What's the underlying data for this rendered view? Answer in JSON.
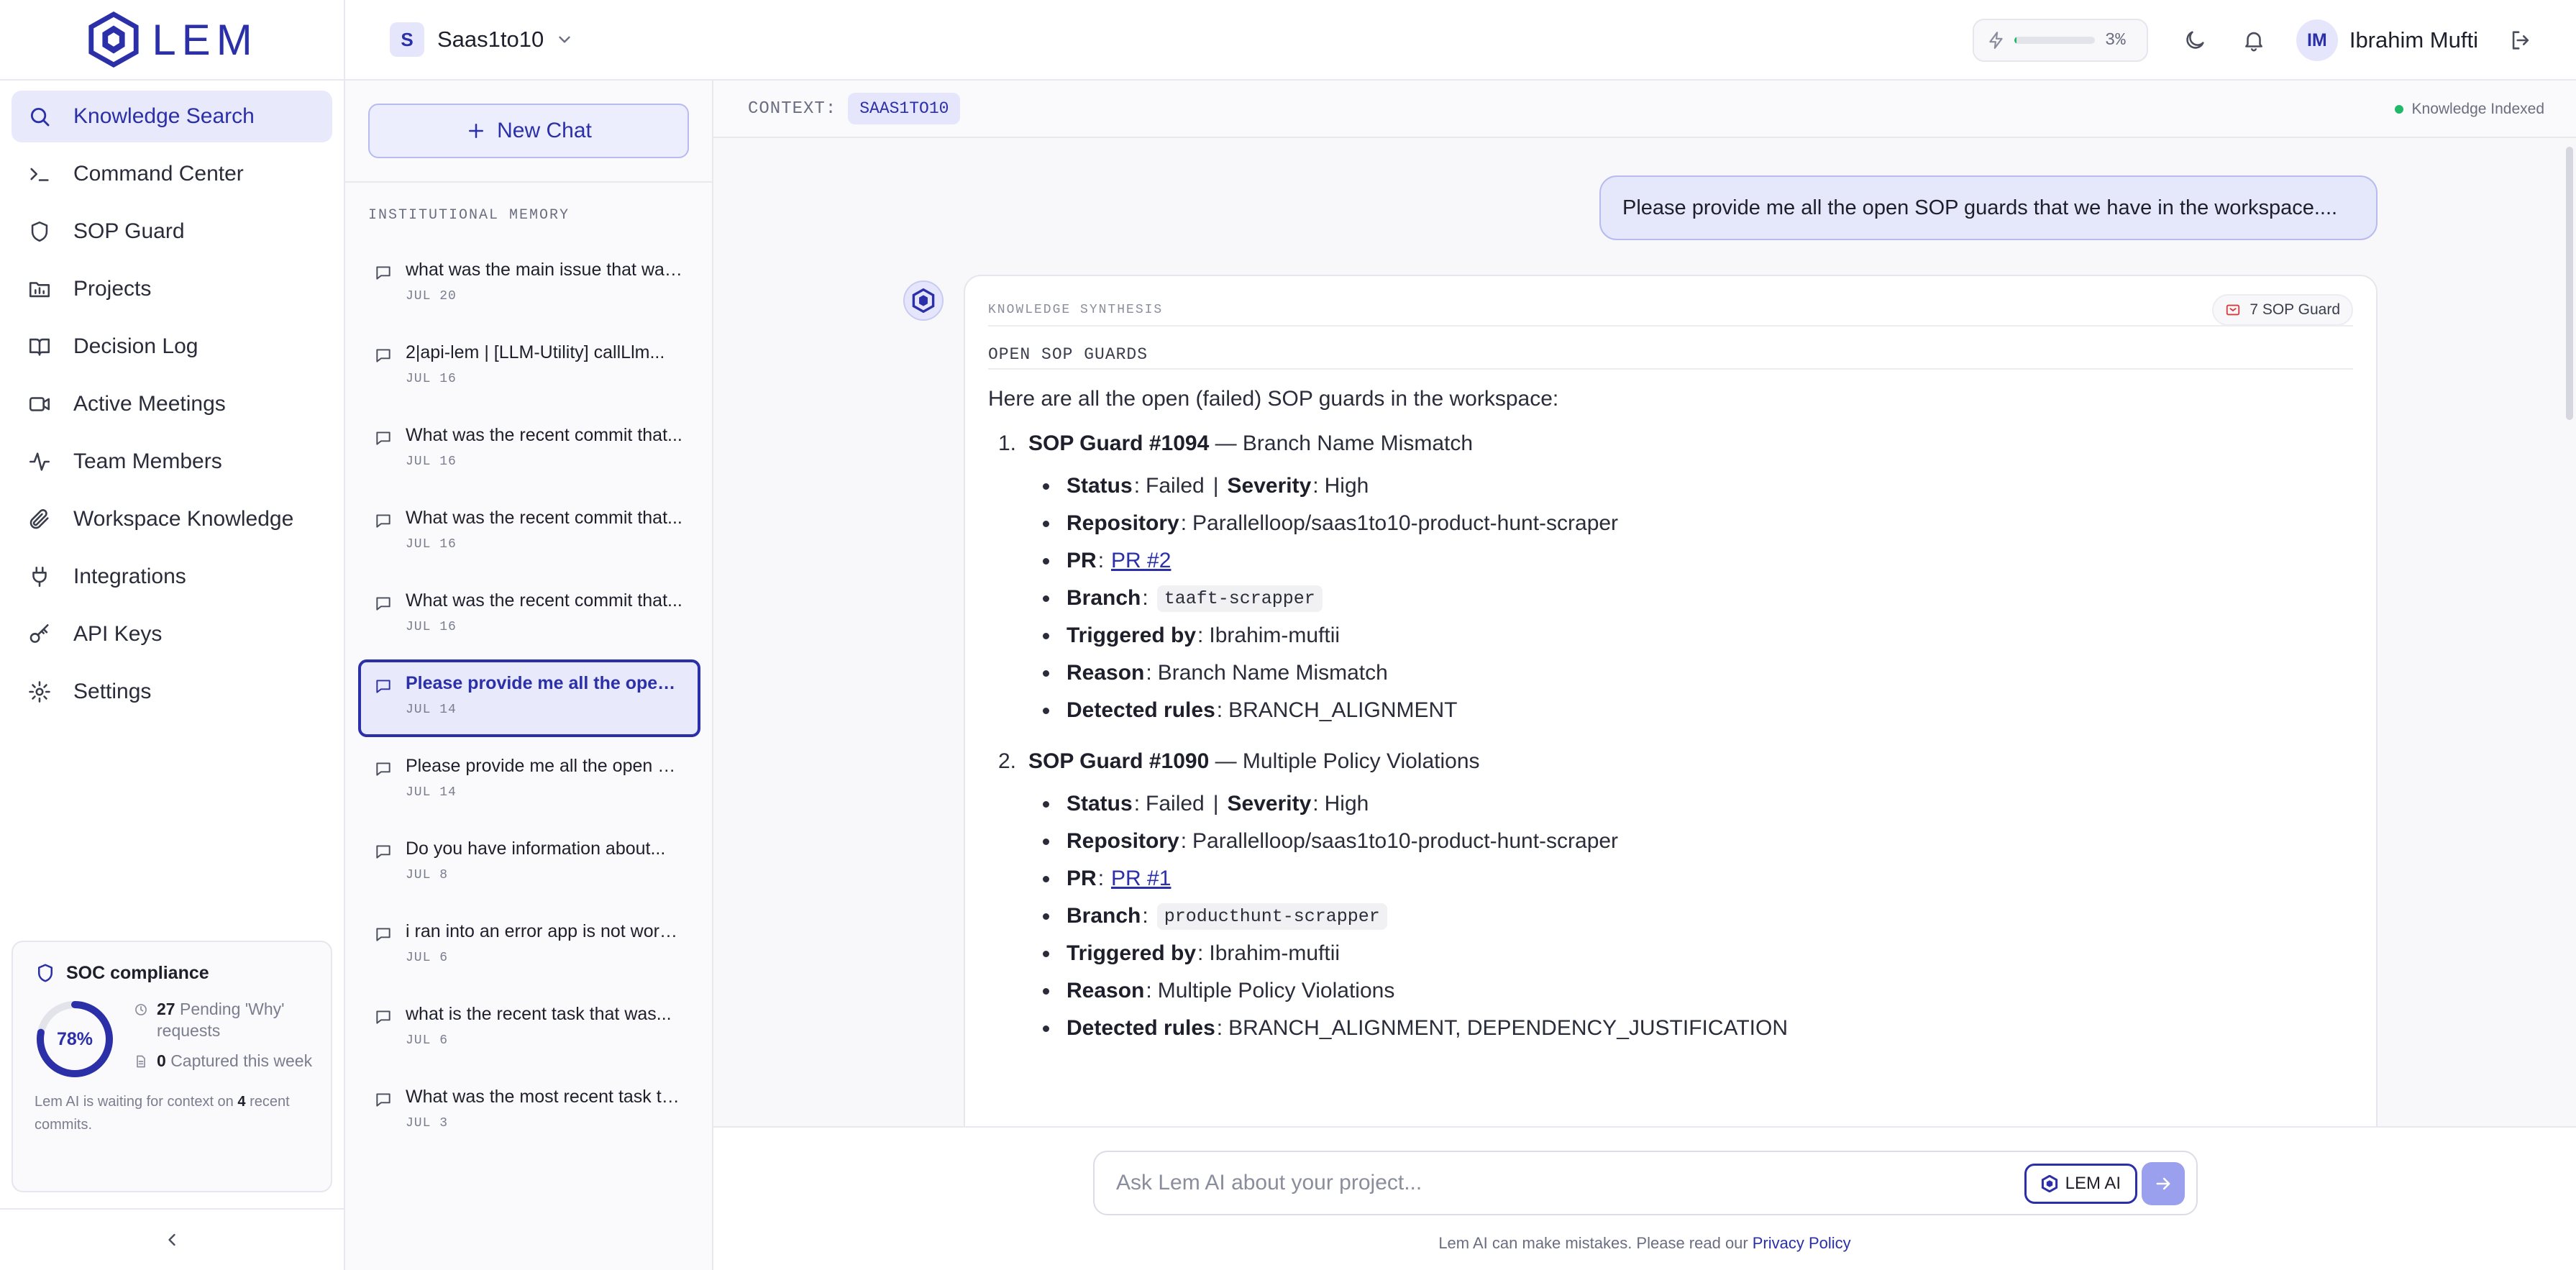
{
  "app": {
    "name": "LEM"
  },
  "workspace": {
    "badge": "S",
    "name": "Saas1to10"
  },
  "usage": {
    "percent_label": "3%",
    "percent": 0.03
  },
  "user": {
    "initials": "IM",
    "name": "Ibrahim Mufti"
  },
  "sidebar": {
    "items": [
      {
        "label": "Knowledge Search",
        "icon": "search-icon",
        "active": true
      },
      {
        "label": "Command Center",
        "icon": "terminal-icon"
      },
      {
        "label": "SOP Guard",
        "icon": "shield-icon"
      },
      {
        "label": "Projects",
        "icon": "folder-icon"
      },
      {
        "label": "Decision Log",
        "icon": "book-open-icon"
      },
      {
        "label": "Active Meetings",
        "icon": "video-icon"
      },
      {
        "label": "Team Members",
        "icon": "activity-icon"
      },
      {
        "label": "Workspace Knowledge",
        "icon": "paperclip-icon"
      },
      {
        "label": "Integrations",
        "icon": "plug-icon"
      },
      {
        "label": "API Keys",
        "icon": "key-icon"
      },
      {
        "label": "Settings",
        "icon": "gear-icon"
      }
    ]
  },
  "soc": {
    "title": "SOC compliance",
    "percent_label": "78%",
    "percent": 0.78,
    "pending_count": "27",
    "pending_label": "Pending 'Why' requests",
    "captured_count": "0",
    "captured_label": "Captured this week",
    "footer_prefix": "Lem AI is waiting for context on",
    "footer_count": "4",
    "footer_suffix": "recent commits."
  },
  "history": {
    "new_chat_label": "New Chat",
    "heading": "INSTITUTIONAL MEMORY",
    "items": [
      {
        "title": "what was the main issue that was...",
        "date": "JUL 20"
      },
      {
        "title": "2|api-lem | [LLM-Utility] callLlm...",
        "date": "JUL 16"
      },
      {
        "title": "What was the recent commit that...",
        "date": "JUL 16"
      },
      {
        "title": "What was the recent commit that...",
        "date": "JUL 16"
      },
      {
        "title": "What was the recent commit that...",
        "date": "JUL 16"
      },
      {
        "title": "Please provide me all the open SOP...",
        "date": "JUL 14",
        "active": true
      },
      {
        "title": "Please provide me all the open SOP...",
        "date": "JUL 14"
      },
      {
        "title": "Do you have information about...",
        "date": "JUL 8"
      },
      {
        "title": "i ran into an error app is not working...",
        "date": "JUL 6"
      },
      {
        "title": "what is the recent task that was...",
        "date": "JUL 6"
      },
      {
        "title": "What was the most recent task that...",
        "date": "JUL 3"
      }
    ]
  },
  "context": {
    "label": "CONTEXT:",
    "value": "SAAS1TO10",
    "status": "Knowledge Indexed"
  },
  "conversation": {
    "user_message": "Please provide me all the open SOP guards that we have in the workspace....",
    "card_kicker": "KNOWLEDGE SYNTHESIS",
    "card_badge": "7  SOP Guard",
    "section_title": "OPEN SOP GUARDS",
    "intro": "Here are all the open (failed) SOP guards in the workspace:",
    "guards": [
      {
        "num": "1.",
        "id": "SOP Guard #1094",
        "title": " — Branch Name Mismatch",
        "status": "Failed",
        "severity": "High",
        "repository": "Parallelloop/saas1to10-product-hunt-scraper",
        "pr": "PR #2",
        "branch": "taaft-scrapper",
        "triggered_by": "Ibrahim-muftii",
        "reason": "Branch Name Mismatch",
        "rules": "BRANCH_ALIGNMENT"
      },
      {
        "num": "2.",
        "id": "SOP Guard #1090",
        "title": " — Multiple Policy Violations",
        "status": "Failed",
        "severity": "High",
        "repository": "Parallelloop/saas1to10-product-hunt-scraper",
        "pr": "PR #1",
        "branch": "producthunt-scrapper",
        "triggered_by": "Ibrahim-muftii",
        "reason": "Multiple Policy Violations",
        "rules": "BRANCH_ALIGNMENT, DEPENDENCY_JUSTIFICATION"
      }
    ],
    "labels": {
      "status": "Status",
      "severity": "Severity",
      "repository": "Repository",
      "pr": "PR",
      "branch": "Branch",
      "triggered_by": "Triggered by",
      "reason": "Reason",
      "rules": "Detected rules"
    }
  },
  "composer": {
    "placeholder": "Ask Lem AI about your project...",
    "mode_label": "LEM AI",
    "disclaimer": "Lem AI can make mistakes. Please read our",
    "policy_link": "Privacy Policy"
  },
  "colors": {
    "accent": "#2b2fa8",
    "accent_soft": "#e8e9fb",
    "success": "#22b86a"
  }
}
